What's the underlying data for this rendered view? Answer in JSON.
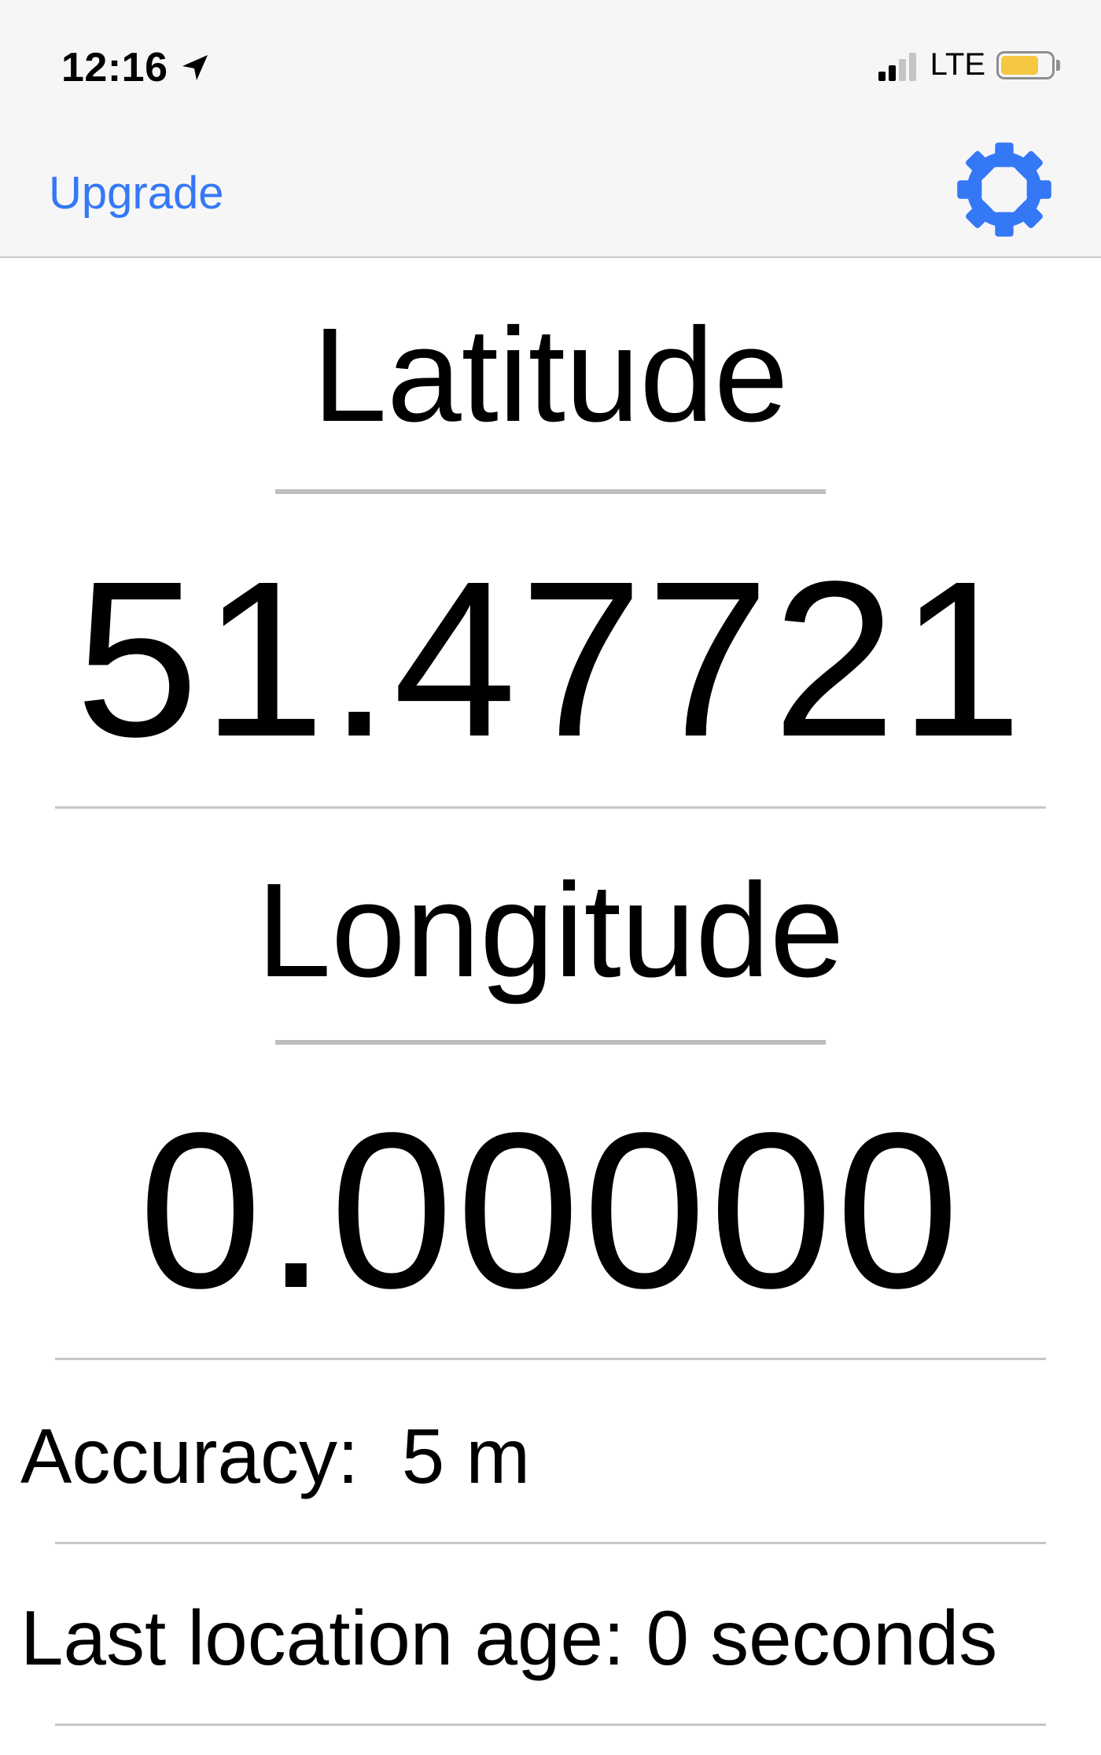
{
  "status_bar": {
    "time": "12:16",
    "location_icon": "location-arrow-icon",
    "network": "LTE",
    "signal_bars_active": 2,
    "signal_bars_total": 4,
    "battery_level": 0.75,
    "battery_color": "#f5c842"
  },
  "nav": {
    "upgrade_label": "Upgrade",
    "settings_icon": "gear-icon",
    "accent_color": "#3478f6"
  },
  "latitude": {
    "label": "Latitude",
    "value": "51.47721"
  },
  "longitude": {
    "label": "Longitude",
    "value": "0.00000"
  },
  "accuracy": {
    "label": "Accuracy:",
    "value": "5 m"
  },
  "location_age": {
    "label": "Last location age:",
    "value": "0 seconds"
  }
}
